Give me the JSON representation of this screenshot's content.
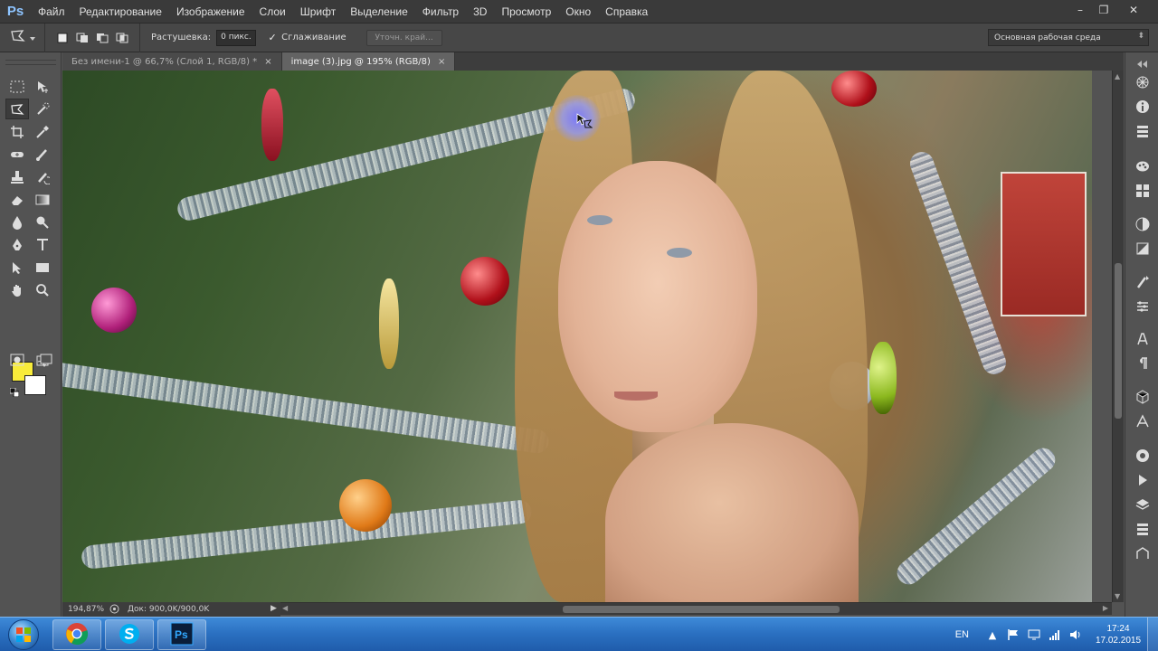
{
  "app": {
    "logo": "Ps",
    "menu": [
      "Файл",
      "Редактирование",
      "Изображение",
      "Слои",
      "Шрифт",
      "Выделение",
      "Фильтр",
      "3D",
      "Просмотр",
      "Окно",
      "Справка"
    ],
    "window_buttons": {
      "minimize": "–",
      "restore": "❐",
      "close": "✕"
    }
  },
  "options": {
    "feather_label": "Растушевка:",
    "feather_value": "0 пикс.",
    "antialias_label": "Сглаживание",
    "antialias_checked": "✓",
    "refine_edge": "Уточн. край...",
    "workspace": "Основная рабочая среда"
  },
  "tabs": [
    {
      "label": "Без имени-1 @ 66,7% (Слой 1, RGB/8) *",
      "close": "×"
    },
    {
      "label": "image (3).jpg @ 195% (RGB/8)",
      "close": "×"
    }
  ],
  "colors": {
    "foreground": "#f8ec3a",
    "background": "#ffffff",
    "accent": "#8ec4ff"
  },
  "status": {
    "zoom": "194,87%",
    "doc": "Док: 900,0K/900,0K"
  },
  "tray": {
    "lang": "EN",
    "time": "17:24",
    "date": "17.02.2015"
  }
}
